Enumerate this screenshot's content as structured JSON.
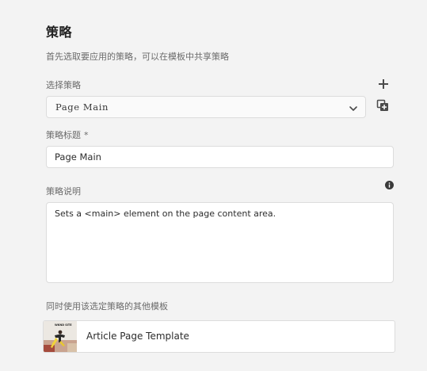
{
  "policy": {
    "heading": "策略",
    "description": "首先选取要应用的策略，可以在模板中共享策略",
    "select_label": "选择策略",
    "selected_policy": "Page Main",
    "add_icon": "plus-icon",
    "duplicate_icon": "duplicate-icon",
    "title_label": "策略标题",
    "required_marker": "*",
    "title_value": "Page Main",
    "description_label": "策略说明",
    "info_icon": "info-icon",
    "description_value": "Sets a <main> element on the page content area.",
    "templates_label": "同时使用该选定策略的其他模板",
    "templates": [
      {
        "name": "Article Page Template",
        "thumbnail_text": "WKND SITE"
      }
    ]
  }
}
